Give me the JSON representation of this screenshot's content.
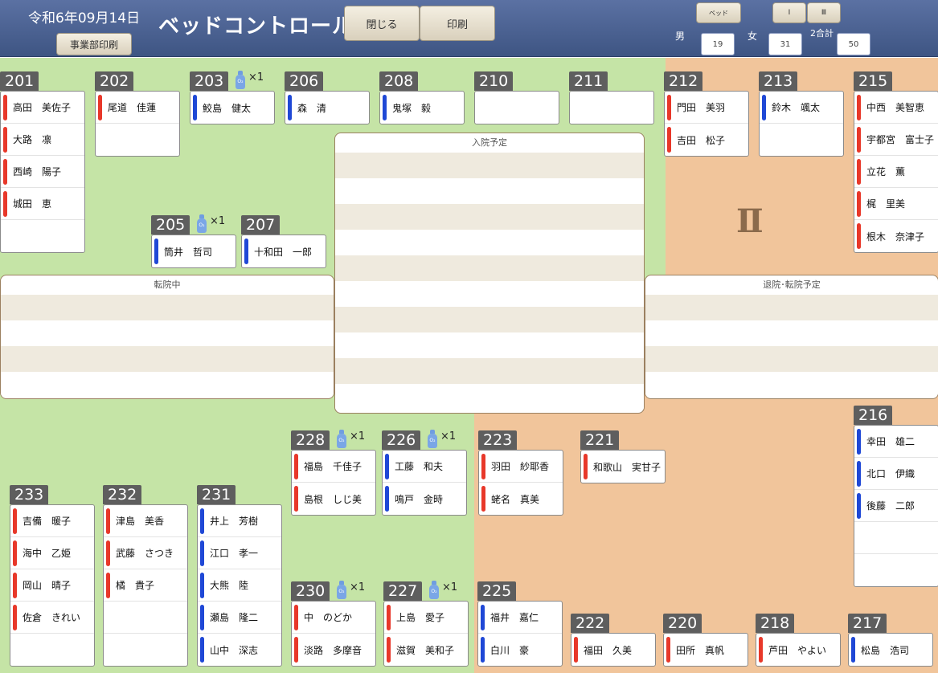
{
  "header": {
    "date": "令和6年09月14日",
    "title": "ベッドコントロール",
    "print_dept_label": "事業部印刷",
    "close_label": "閉じる",
    "print_label": "印刷",
    "bed_label": "ベッド",
    "ward1_label": "Ⅰ",
    "ward3_label": "Ⅲ",
    "male_label": "男",
    "male_count": "19",
    "female_label": "女",
    "female_count": "31",
    "total_label": "2合計",
    "total_count": "50"
  },
  "panels": {
    "admission_title": "入院予定",
    "transfer_title": "転院中",
    "discharge_title": "退院･転院予定"
  },
  "ward_mark": "Ⅱ",
  "oxygen": {
    "tank_label": "O₂",
    "count": "×1"
  },
  "rooms": [
    {
      "num": "201",
      "patients": [
        {
          "name": "高田　美佐子",
          "sex": "f"
        },
        {
          "name": "大路　凛",
          "sex": "f"
        },
        {
          "name": "西崎　陽子",
          "sex": "f"
        },
        {
          "name": "城田　恵",
          "sex": "f"
        }
      ]
    },
    {
      "num": "202",
      "patients": [
        {
          "name": "尾道　佳蓮",
          "sex": "f"
        }
      ]
    },
    {
      "num": "203",
      "patients": [
        {
          "name": "鮫島　健太",
          "sex": "m"
        }
      ]
    },
    {
      "num": "206",
      "patients": [
        {
          "name": "森　清",
          "sex": "m"
        }
      ]
    },
    {
      "num": "208",
      "patients": [
        {
          "name": "鬼塚　毅",
          "sex": "m"
        }
      ]
    },
    {
      "num": "210",
      "patients": []
    },
    {
      "num": "211",
      "patients": []
    },
    {
      "num": "212",
      "patients": [
        {
          "name": "門田　美羽",
          "sex": "f"
        },
        {
          "name": "吉田　松子",
          "sex": "f"
        }
      ]
    },
    {
      "num": "213",
      "patients": [
        {
          "name": "鈴木　颯太",
          "sex": "m"
        }
      ]
    },
    {
      "num": "215",
      "patients": [
        {
          "name": "中西　美智恵",
          "sex": "f"
        },
        {
          "name": "宇都宮　富士子",
          "sex": "f"
        },
        {
          "name": "立花　薫",
          "sex": "f"
        },
        {
          "name": "梶　里美",
          "sex": "f"
        },
        {
          "name": "根木　奈津子",
          "sex": "f"
        }
      ]
    },
    {
      "num": "205",
      "patients": [
        {
          "name": "筒井　哲司",
          "sex": "m"
        }
      ]
    },
    {
      "num": "207",
      "patients": [
        {
          "name": "十和田　一郎",
          "sex": "m"
        }
      ]
    },
    {
      "num": "216",
      "patients": [
        {
          "name": "幸田　雄二",
          "sex": "m"
        },
        {
          "name": "北口　伊織",
          "sex": "m"
        },
        {
          "name": "後藤　二郎",
          "sex": "m"
        }
      ]
    },
    {
      "num": "228",
      "patients": [
        {
          "name": "福島　千佳子",
          "sex": "f"
        },
        {
          "name": "島根　しじ美",
          "sex": "f"
        }
      ]
    },
    {
      "num": "226",
      "patients": [
        {
          "name": "工藤　和夫",
          "sex": "m"
        },
        {
          "name": "鳴戸　金時",
          "sex": "m"
        }
      ]
    },
    {
      "num": "223",
      "patients": [
        {
          "name": "羽田　紗耶香",
          "sex": "f"
        },
        {
          "name": "蛯名　真美",
          "sex": "f"
        }
      ]
    },
    {
      "num": "221",
      "patients": [
        {
          "name": "和歌山　実甘子",
          "sex": "f"
        }
      ]
    },
    {
      "num": "233",
      "patients": [
        {
          "name": "吉備　暖子",
          "sex": "f"
        },
        {
          "name": "海中　乙姫",
          "sex": "f"
        },
        {
          "name": "岡山　晴子",
          "sex": "f"
        },
        {
          "name": "佐倉　きれい",
          "sex": "f"
        }
      ]
    },
    {
      "num": "232",
      "patients": [
        {
          "name": "津島　美香",
          "sex": "f"
        },
        {
          "name": "武藤　さつき",
          "sex": "f"
        },
        {
          "name": "橘　貴子",
          "sex": "f"
        }
      ]
    },
    {
      "num": "231",
      "patients": [
        {
          "name": "井上　芳樹",
          "sex": "m"
        },
        {
          "name": "江口　孝一",
          "sex": "m"
        },
        {
          "name": "大熊　陸",
          "sex": "m"
        },
        {
          "name": "瀬島　隆二",
          "sex": "m"
        },
        {
          "name": "山中　深志",
          "sex": "m"
        }
      ]
    },
    {
      "num": "230",
      "patients": [
        {
          "name": "中　のどか",
          "sex": "f"
        },
        {
          "name": "淡路　多摩音",
          "sex": "f"
        }
      ]
    },
    {
      "num": "227",
      "patients": [
        {
          "name": "上島　愛子",
          "sex": "f"
        },
        {
          "name": "滋賀　美和子",
          "sex": "f"
        }
      ]
    },
    {
      "num": "225",
      "patients": [
        {
          "name": "福井　嘉仁",
          "sex": "m"
        },
        {
          "name": "白川　豪",
          "sex": "m"
        }
      ]
    },
    {
      "num": "222",
      "patients": [
        {
          "name": "福田　久美",
          "sex": "f"
        }
      ]
    },
    {
      "num": "220",
      "patients": [
        {
          "name": "田所　真帆",
          "sex": "f"
        }
      ]
    },
    {
      "num": "218",
      "patients": [
        {
          "name": "芦田　やよい",
          "sex": "f"
        }
      ]
    },
    {
      "num": "217",
      "patients": [
        {
          "name": "松島　浩司",
          "sex": "m"
        }
      ]
    }
  ]
}
